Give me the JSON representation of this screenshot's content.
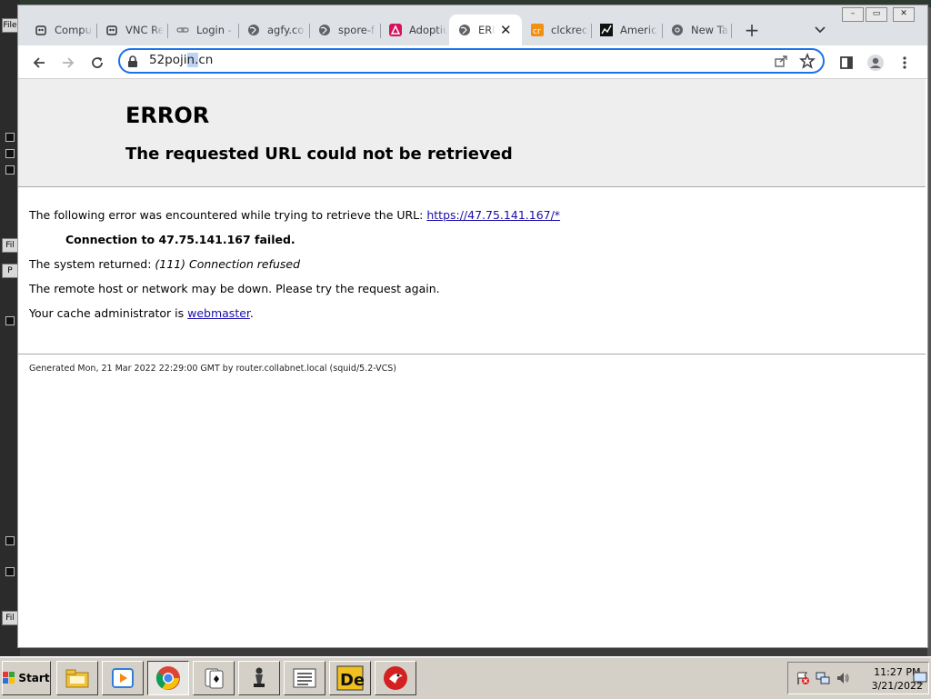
{
  "browser": {
    "tabs": [
      {
        "title": "Computer",
        "icon": "robot-icon"
      },
      {
        "title": "VNC Re",
        "icon": "robot-icon"
      },
      {
        "title": "Login -",
        "icon": "link-icon"
      },
      {
        "title": "agfy.co",
        "icon": "globe-icon"
      },
      {
        "title": "spore-f",
        "icon": "globe-icon"
      },
      {
        "title": "Adoptiu",
        "icon": "adoptium-icon"
      },
      {
        "title": "ERR",
        "icon": "globe-icon",
        "active": true
      },
      {
        "title": "clckreco",
        "icon": "cr-icon"
      },
      {
        "title": "America",
        "icon": "chart-icon"
      },
      {
        "title": "New Ta",
        "icon": "chrome-icon"
      }
    ],
    "address": {
      "prefix": "52poji",
      "selected": "n.",
      "suffix": "cn"
    },
    "accent": "#1a73e8"
  },
  "page": {
    "heading": "ERROR",
    "subheading": "The requested URL could not be retrieved",
    "line1_text": "The following error was encountered while trying to retrieve the URL: ",
    "line1_link": "https://47.75.141.167/*",
    "line2": "Connection to 47.75.141.167 failed.",
    "line3_text": "The system returned: ",
    "line3_err": "(111) Connection refused",
    "line4": "The remote host or network may be down. Please try the request again.",
    "line5_text": "Your cache administrator is ",
    "line5_link": "webmaster",
    "line5_end": ".",
    "footer": "Generated Mon, 21 Mar 2022 22:29:00 GMT by router.collabnet.local (squid/5.2-VCS)"
  },
  "taskbar": {
    "start_label": "Start",
    "apps": [
      "file-manager-icon",
      "media-player-icon",
      "chrome-icon",
      "cards-icon",
      "chess-icon",
      "list-icon",
      "de-icon",
      "red-bird-icon"
    ],
    "active_app": "chrome-icon",
    "time": "11:27 PM",
    "date": "3/21/2022"
  },
  "background_app": {
    "labels": [
      "File",
      "Fil",
      "P",
      "Fil"
    ]
  }
}
